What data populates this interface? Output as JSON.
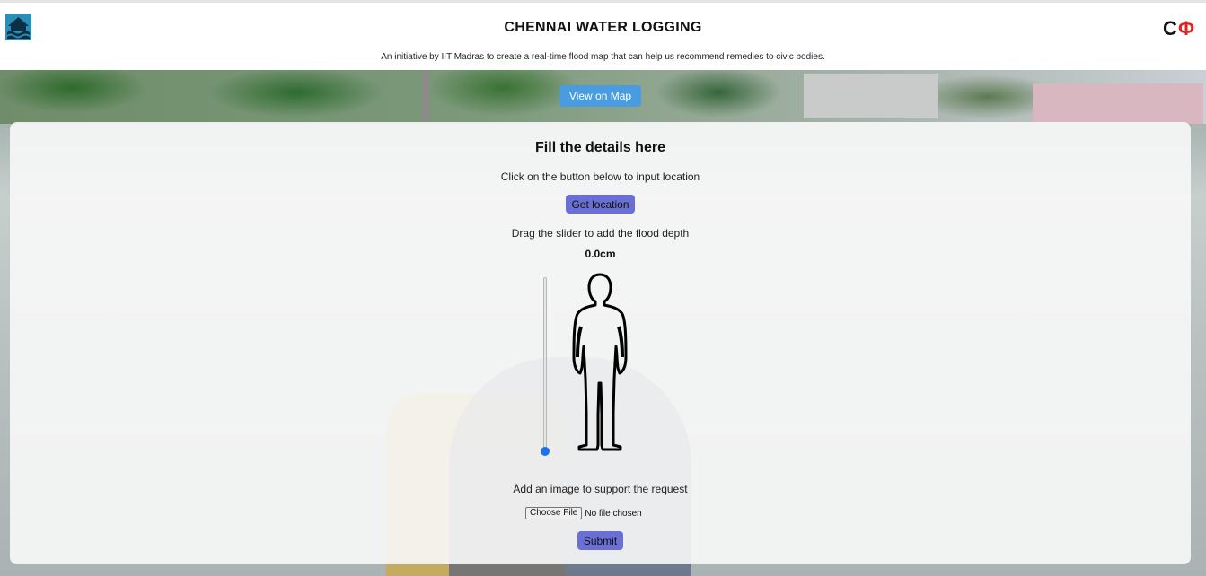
{
  "header": {
    "title": "CHENNAI WATER LOGGING",
    "subtitle": "An initiative by IIT Madras to create a real-time flood map that can help us recommend remedies to civic bodies.",
    "left_logo_icon": "house-flood-icon",
    "right_logo": {
      "c": "C",
      "phi": "Φ"
    }
  },
  "nav": {
    "map_button_label": "View on Map"
  },
  "form": {
    "title": "Fill the details here",
    "location_hint": "Click on the button below to input location",
    "get_location_label": "Get location",
    "depth_hint": "Drag the slider to add the flood depth",
    "depth_value": "0.0cm",
    "depth_level": 0,
    "figure_icon": "person-silhouette-icon",
    "image_hint": "Add an image to support the request",
    "file_button_label": "Choose File",
    "file_status": "No file chosen",
    "submit_label": "Submit"
  },
  "colors": {
    "map_button": "#4a9ce0",
    "purple_button": "#6a6fd4",
    "slider_thumb": "#1a73e8",
    "phi_red": "#e02424"
  }
}
